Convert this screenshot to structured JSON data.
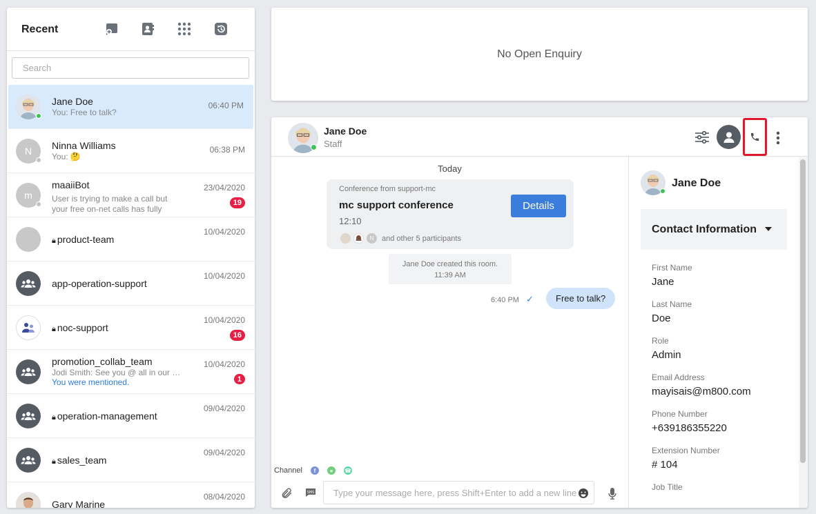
{
  "recent": {
    "title": "Recent",
    "search_placeholder": "Search",
    "items": [
      {
        "name": "Jane Doe",
        "preview": "You: Free to talk?",
        "time": "06:40 PM"
      },
      {
        "initial": "N",
        "name": "Ninna Williams",
        "preview": "You: 🤔",
        "time": "06:38 PM"
      },
      {
        "initial": "m",
        "name": "maaiiBot",
        "preview": "User is trying to make a call but your free on-net calls has fully consume...",
        "time": "23/04/2020",
        "badge": "19"
      },
      {
        "name": "product-team",
        "time": "10/04/2020"
      },
      {
        "name": "app-operation-support",
        "time": "10/04/2020"
      },
      {
        "name": "noc-support",
        "time": "10/04/2020",
        "badge": "16"
      },
      {
        "name": "promotion_collab_team",
        "preview": "Jodi Smith: See you @ all in our me...",
        "mention": "You were mentioned.",
        "time": "10/04/2020",
        "badge": "1"
      },
      {
        "name": "operation-management",
        "time": "09/04/2020"
      },
      {
        "name": "sales_team",
        "time": "09/04/2020"
      },
      {
        "name": "Gary Marine",
        "time": "08/04/2020"
      }
    ]
  },
  "enquiry": {
    "text": "No Open Enquiry"
  },
  "chat": {
    "header": {
      "name": "Jane Doe",
      "role": "Staff"
    },
    "day_label": "Today",
    "conference": {
      "from": "Conference from support-mc",
      "title": "mc support conference",
      "time": "12:10",
      "details_label": "Details",
      "participant_initial": "N",
      "participants_text": "and other 5 participants"
    },
    "system_message": {
      "line1": "Jane Doe created this room.",
      "line2": "11:39 AM"
    },
    "message": {
      "time": "6:40 PM",
      "text": "Free to talk?"
    },
    "channel_label": "Channel",
    "input_placeholder": "Type your message here, press Shift+Enter to add a new line"
  },
  "contact": {
    "name": "Jane Doe",
    "section_title": "Contact Information",
    "fields": [
      {
        "label": "First Name",
        "value": "Jane"
      },
      {
        "label": "Last Name",
        "value": "Doe"
      },
      {
        "label": "Role",
        "value": "Admin"
      },
      {
        "label": "Email Address",
        "value": "mayisais@m800.com"
      },
      {
        "label": "Phone Number",
        "value": "+639186355220"
      },
      {
        "label": "Extension Number",
        "value": "# 104"
      },
      {
        "label": "Job Title",
        "value": ""
      }
    ]
  },
  "colors": {
    "accent": "#3b7ddd",
    "badge": "#e62044",
    "online": "#3ec356",
    "highlight_border": "#e0182d"
  }
}
